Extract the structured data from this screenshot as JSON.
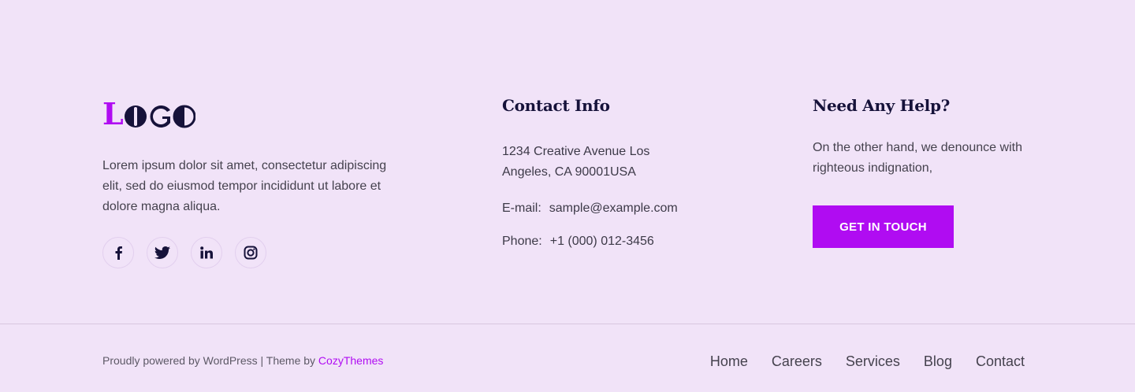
{
  "logo": {
    "first_letter": "L",
    "rest": "OGO",
    "accent_color": "#b00cf2"
  },
  "about": {
    "text": "Lorem ipsum dolor sit amet, consectetur adipiscing elit, sed do eiusmod tempor incididunt ut labore et dolore magna aliqua."
  },
  "socials": [
    {
      "icon": "facebook-icon"
    },
    {
      "icon": "twitter-icon"
    },
    {
      "icon": "linkedin-icon"
    },
    {
      "icon": "instagram-icon"
    }
  ],
  "contact": {
    "title": "Contact Info",
    "address": "1234 Creative Avenue Los Angeles, CA 90001USA",
    "email_label": "E-mail:",
    "email": "sample@example.com",
    "phone_label": "Phone:",
    "phone": "+1 (000) 012-3456"
  },
  "help": {
    "title": "Need Any Help?",
    "text": "On the other hand, we denounce with righteous indignation,",
    "button_label": "GET IN TOUCH"
  },
  "footer": {
    "powered_text": "Proudly powered by WordPress",
    "separator": " | ",
    "theme_text": "Theme by ",
    "theme_link": "CozyThemes",
    "nav": [
      "Home",
      "Careers",
      "Services",
      "Blog",
      "Contact"
    ]
  },
  "colors": {
    "background": "#f1e3f8",
    "accent": "#b00cf2",
    "heading": "#16123a"
  }
}
